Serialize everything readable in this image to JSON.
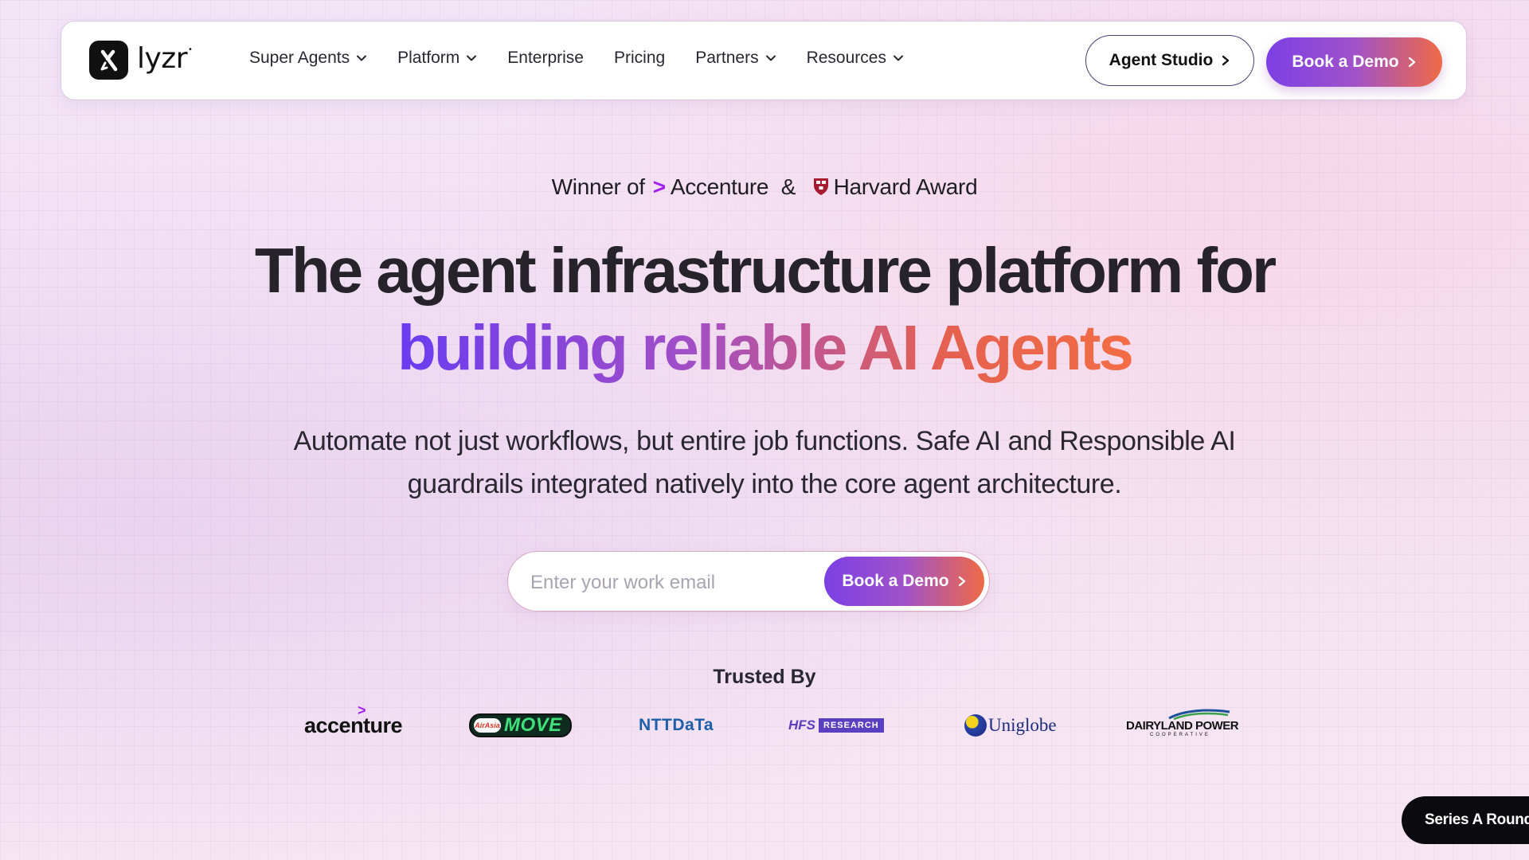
{
  "brand": {
    "name": "lyzr",
    "mark": "•"
  },
  "nav": {
    "items": [
      {
        "label": "Super Agents",
        "has_dropdown": true
      },
      {
        "label": "Platform",
        "has_dropdown": true
      },
      {
        "label": "Enterprise",
        "has_dropdown": false
      },
      {
        "label": "Pricing",
        "has_dropdown": false
      },
      {
        "label": "Partners",
        "has_dropdown": true
      },
      {
        "label": "Resources",
        "has_dropdown": true
      }
    ],
    "agent_studio_label": "Agent Studio",
    "book_demo_label": "Book a Demo"
  },
  "hero": {
    "award": {
      "prefix": "Winner of",
      "accenture_mark": ">",
      "accenture": "Accenture",
      "amp": "&",
      "harvard": "Harvard Award"
    },
    "headline_line1": "The agent infrastructure platform for",
    "headline_line2": "building reliable AI Agents",
    "subtext_line1": "Automate not just workflows, but entire job functions. Safe AI and Responsible AI",
    "subtext_line2": "guardrails integrated natively into the core agent architecture.",
    "email_placeholder": "Enter your work email",
    "email_value": "",
    "cta_label": "Book a Demo"
  },
  "trusted": {
    "title": "Trusted By",
    "logos": {
      "accenture": "accenture",
      "accenture_mark": ">",
      "airasia_small": "AirAsia",
      "move": "MOVE",
      "ntt": "NTTDaTa",
      "hfs_left": "HFS",
      "hfs_right": "RESEARCH",
      "uniglobe": "Uniglobe",
      "dairyland": "DAIRYLAND POWER",
      "dairyland_sub": "COOPERATIVE"
    }
  },
  "badge": {
    "label": "Series A Round"
  },
  "colors": {
    "accent_purple": "#7b3fe4",
    "accent_orange": "#ef6a45",
    "accenture_purple": "#a020f0"
  },
  "icons": [
    "lyzr-logo-icon",
    "chevron-down-icon",
    "chevron-right-icon",
    "harvard-shield-icon"
  ]
}
